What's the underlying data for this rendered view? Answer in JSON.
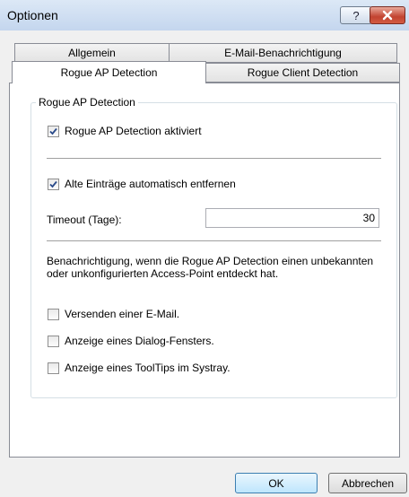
{
  "window": {
    "title": "Optionen"
  },
  "tabs": {
    "row_back": [
      "Allgemein",
      "E-Mail-Benachrichtigung"
    ],
    "row_front": [
      "Rogue AP Detection",
      "Rogue Client Detection"
    ],
    "active": "Rogue AP Detection"
  },
  "group": {
    "title": "Rogue AP Detection",
    "enable_label": "Rogue AP Detection aktiviert",
    "enable_checked": true,
    "auto_remove_label": "Alte Einträge automatisch entfernen",
    "auto_remove_checked": true,
    "timeout_label": "Timeout (Tage):",
    "timeout_value": "30",
    "notify_text": "Benachrichtigung, wenn die Rogue AP Detection einen unbekannten oder unkonfigurierten Access-Point entdeckt hat.",
    "options": [
      {
        "label": "Versenden einer E-Mail.",
        "checked": false
      },
      {
        "label": "Anzeige eines Dialog-Fensters.",
        "checked": false
      },
      {
        "label": "Anzeige eines ToolTips im Systray.",
        "checked": false
      }
    ]
  },
  "buttons": {
    "ok": "OK",
    "cancel": "Abbrechen",
    "help": "?"
  }
}
